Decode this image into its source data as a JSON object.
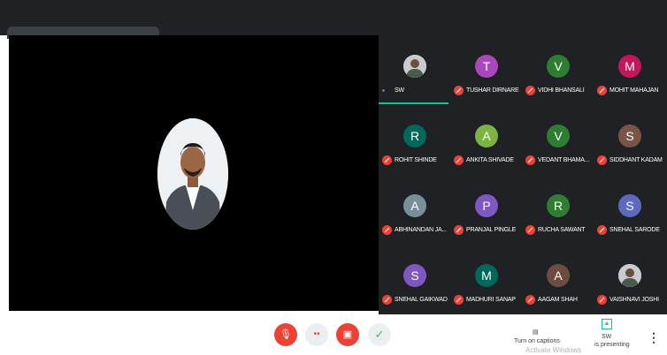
{
  "participants": [
    {
      "initial": "",
      "name": "SW",
      "color": "#9e9e9e",
      "photo": true,
      "speaking": true
    },
    {
      "initial": "T",
      "name": "TUSHAR DIRNARE",
      "color": "#ab47bc"
    },
    {
      "initial": "V",
      "name": "VIDHI BHANSALI",
      "color": "#2e7d32"
    },
    {
      "initial": "M",
      "name": "MOHIT MAHAJAN",
      "color": "#c2185b"
    },
    {
      "initial": "R",
      "name": "ROHIT SHINDE",
      "color": "#00695c"
    },
    {
      "initial": "A",
      "name": "ANKITA SHIVADE",
      "color": "#7cb342"
    },
    {
      "initial": "V",
      "name": "VEDANT BHAMA...",
      "color": "#2e7d32"
    },
    {
      "initial": "S",
      "name": "SIDDHANT KADAM",
      "color": "#795548"
    },
    {
      "initial": "A",
      "name": "ABHINANDAN JA...",
      "color": "#78909c"
    },
    {
      "initial": "P",
      "name": "PRANJAL PINGLE",
      "color": "#7e57c2"
    },
    {
      "initial": "R",
      "name": "RUCHA SAWANT",
      "color": "#2e7d32"
    },
    {
      "initial": "S",
      "name": "SNEHAL SARODE",
      "color": "#5c6bc0"
    },
    {
      "initial": "S",
      "name": "SNEHAL GAIKWAD",
      "color": "#7e57c2"
    },
    {
      "initial": "M",
      "name": "MADHURI SANAP",
      "color": "#00695c"
    },
    {
      "initial": "A",
      "name": "AAGAM SHAH",
      "color": "#6d4c41"
    },
    {
      "initial": "",
      "name": "VAISHNAVI JOSHI",
      "color": "#9e9e9e",
      "photo": true
    }
  ],
  "controls": {
    "mic_icon": "mic-off-icon",
    "more_icon": "dots-icon",
    "camera_icon": "camera-off-icon",
    "confirm_icon": "check-icon",
    "check_glyph": "✓"
  },
  "right": {
    "turn_on_label": "Turn on captions",
    "presenter_name": "SW",
    "presenting_label": "is presenting",
    "watermark": "Activate Windows"
  }
}
